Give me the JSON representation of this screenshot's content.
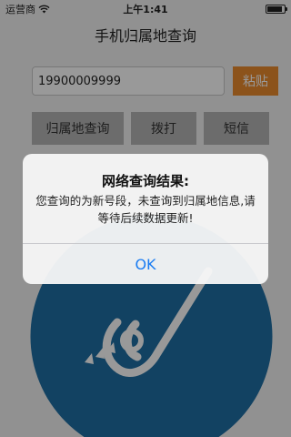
{
  "status_bar": {
    "carrier": "运营商",
    "time": "上午1:41",
    "battery_level": 0.9
  },
  "nav": {
    "title": "手机归属地查询"
  },
  "phone": {
    "value": "19900009999",
    "paste_label": "粘贴"
  },
  "actions": {
    "lookup_label": "归属地查询",
    "call_label": "拨打",
    "sms_label": "短信"
  },
  "alert": {
    "title": "网络查询结果:",
    "message": "您查询的为新号段，未查询到归属地信息,请等待后续数据更新!",
    "ok_label": "OK"
  },
  "colors": {
    "accent_orange": "#e98a2e",
    "logo_blue": "#1f6fa3",
    "link_blue": "#1a7cf2",
    "button_gray": "#b5b5b5"
  },
  "icons": [
    "wifi-icon",
    "battery-icon",
    "phone-logo-icon"
  ]
}
